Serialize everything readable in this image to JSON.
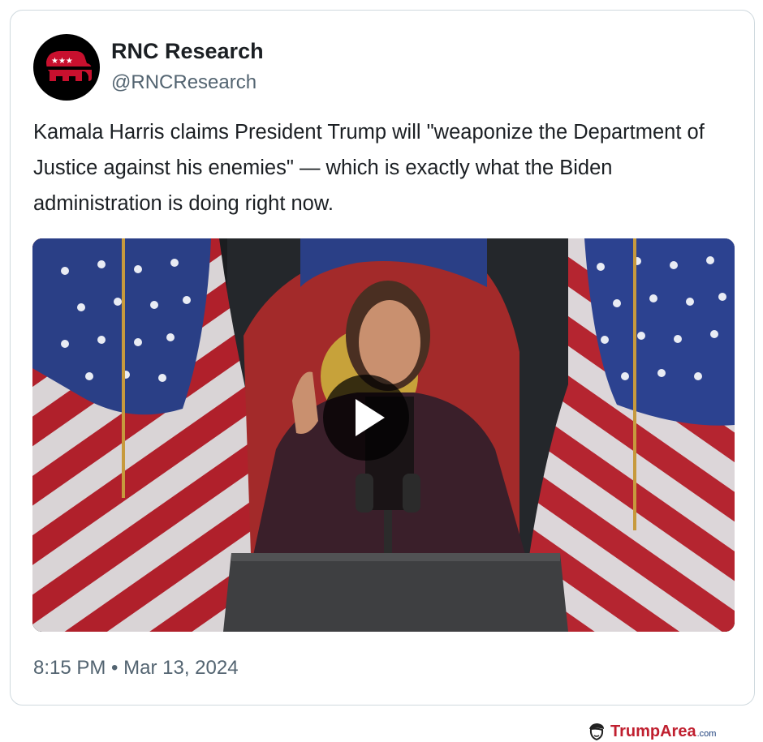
{
  "tweet": {
    "display_name": "RNC Research",
    "handle": "@RNCResearch",
    "text": "Kamala Harris claims President Trump will \"weaponize the Department of Justice against his enemies\" — which is exactly what the Biden administration is doing right now.",
    "timestamp": "8:15 PM • Mar 13, 2024",
    "avatar_icon": "elephant-logo-icon",
    "media": {
      "type": "video",
      "control_icon": "play-icon"
    }
  },
  "watermark": {
    "brand": "TrumpArea",
    "tld": ".com",
    "icon": "trump-face-icon"
  },
  "colors": {
    "text": "#1b1f23",
    "secondary_text": "#536471",
    "border": "#cfd9de",
    "logo_red": "#c8102e",
    "watermark_red": "#c01f2f"
  }
}
